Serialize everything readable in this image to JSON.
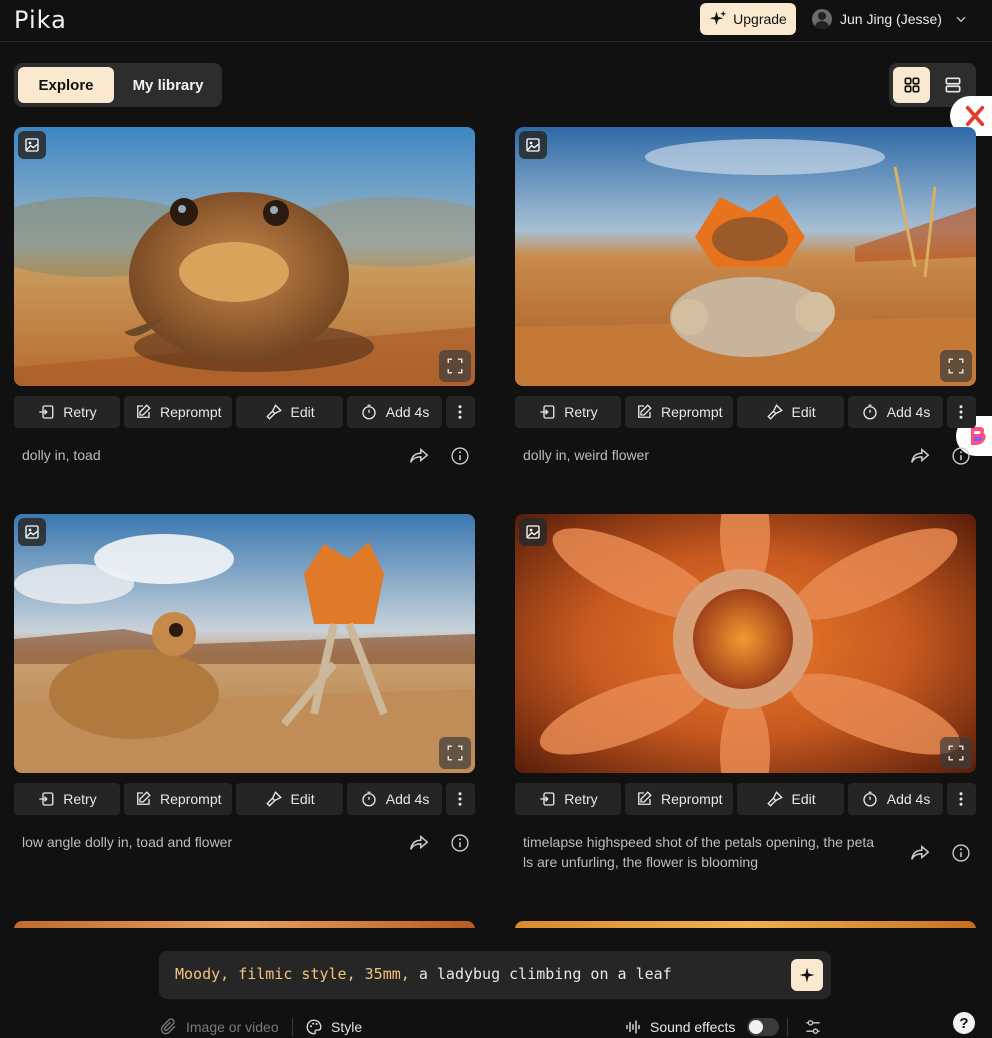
{
  "app": {
    "logo": "Pika"
  },
  "header": {
    "upgrade_label": "Upgrade",
    "user_name": "Jun Jing (Jesse)"
  },
  "tabs": [
    {
      "label": "Explore",
      "active": true
    },
    {
      "label": "My library",
      "active": false
    }
  ],
  "view_toggle": {
    "selected": "grid"
  },
  "actions": {
    "retry": "Retry",
    "reprompt": "Reprompt",
    "edit": "Edit",
    "add": "Add 4s"
  },
  "cards": [
    {
      "caption": "dolly in, toad"
    },
    {
      "caption": "dolly in, weird flower"
    },
    {
      "caption": "low angle dolly in, toad and flower"
    },
    {
      "caption": "timelapse highspeed shot of the petals opening, the peta\nls are unfurling, the flower is blooming"
    }
  ],
  "composer": {
    "prompt_highlight": "Moody, filmic style, 35mm,",
    "prompt_rest": " a ladybug climbing on a leaf",
    "media_label": "Image or video",
    "style_label": "Style",
    "sound_label": "Sound effects",
    "sound_enabled": false,
    "help_label": "?"
  },
  "colors": {
    "accent": "#fbe9cf",
    "background": "#111111",
    "prompt_highlight": "#f4c27a"
  }
}
